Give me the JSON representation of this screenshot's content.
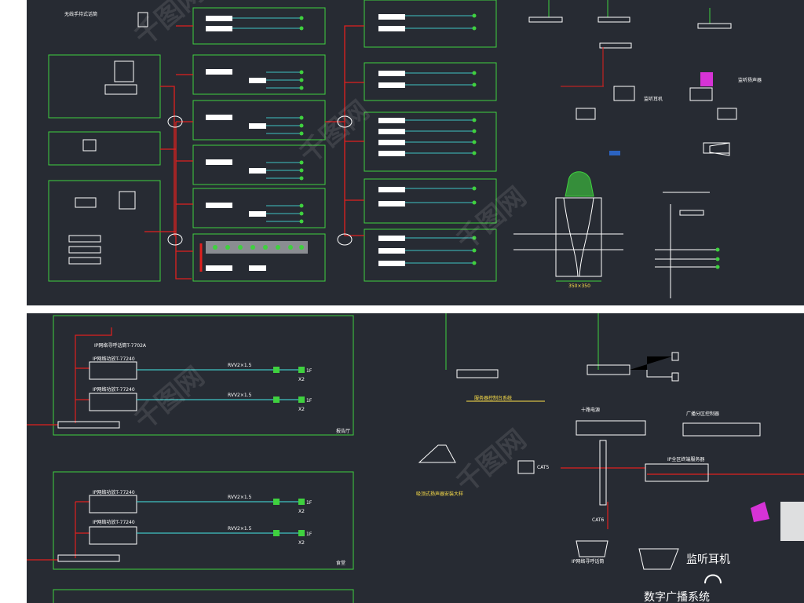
{
  "top_panel": {
    "labels": {
      "wireless_mic": "无线手持式话筒",
      "monitor_speaker": "监听扬声器",
      "monitor_earphone": "监听耳机",
      "dim_label": "350×350"
    }
  },
  "bottom_panel": {
    "labels": {
      "paging_mic": "IP网络寻呼话筒T-7702A",
      "amp_1": "IP网络功放T-77240",
      "amp_2": "IP网络功放T-77240",
      "amp_3": "IP网络功放T-77240",
      "amp_4": "IP网络功放T-77240",
      "cable_1": "RVV2×1.5",
      "cable_2": "RVV2×1.5",
      "cable_3": "RVV2×1.5",
      "cable_4": "RVV2×1.5",
      "cable_5": "RVV2×1.5",
      "cable_6": "RVV2×1.5",
      "floor_1": "1F",
      "floor_2": "1F",
      "floor_3": "1F",
      "floor_4": "1F",
      "x2_1": "X2",
      "x2_2": "X2",
      "x2_3": "X2",
      "x2_4": "X2",
      "room_1": "报告厅",
      "room_2": "食堂",
      "cat5": "CAT5",
      "cat6": "CAT6",
      "server": "IP全区终端服务器",
      "monitor_earphone_big": "监听耳机",
      "paging_station": "IP网络寻呼话筒",
      "tenth_amp": "十路电源",
      "partition": "广播分区控制器",
      "lobby": "服务器控制台系统",
      "speaker_install": "吸顶式扬声器安装大样",
      "bottom_title": "数字广播系统"
    }
  },
  "colors": {
    "background": "#272b33",
    "green_box": "#3fd13f",
    "red_wire": "#e0201e",
    "cyan_wire": "#3fc3c3",
    "yellow_text": "#ffe24a"
  },
  "watermark": "千图网"
}
